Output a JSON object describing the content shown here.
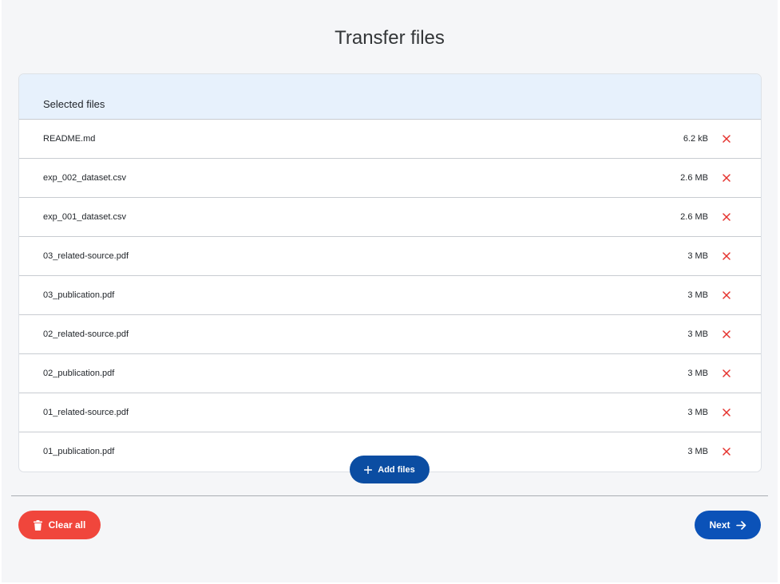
{
  "page": {
    "title": "Transfer files"
  },
  "panel": {
    "header_label": "Selected files",
    "files": [
      {
        "name": "README.md",
        "size": "6.2 kB"
      },
      {
        "name": "exp_002_dataset.csv",
        "size": "2.6 MB"
      },
      {
        "name": "exp_001_dataset.csv",
        "size": "2.6 MB"
      },
      {
        "name": "03_related-source.pdf",
        "size": "3 MB"
      },
      {
        "name": "03_publication.pdf",
        "size": "3 MB"
      },
      {
        "name": "02_related-source.pdf",
        "size": "3 MB"
      },
      {
        "name": "02_publication.pdf",
        "size": "3 MB"
      },
      {
        "name": "01_related-source.pdf",
        "size": "3 MB"
      },
      {
        "name": "01_publication.pdf",
        "size": "3 MB"
      }
    ],
    "remove_icon": "close-icon"
  },
  "actions": {
    "add_files_label": "Add files",
    "add_files_icon": "plus-icon",
    "clear_all_label": "Clear all",
    "clear_all_icon": "trash-icon",
    "next_label": "Next",
    "next_icon": "arrow-right-icon"
  },
  "colors": {
    "primary": "#0b52b8",
    "danger": "#f0463c",
    "remove_icon": "#e5322d",
    "header_bg": "#e7f1fc"
  }
}
